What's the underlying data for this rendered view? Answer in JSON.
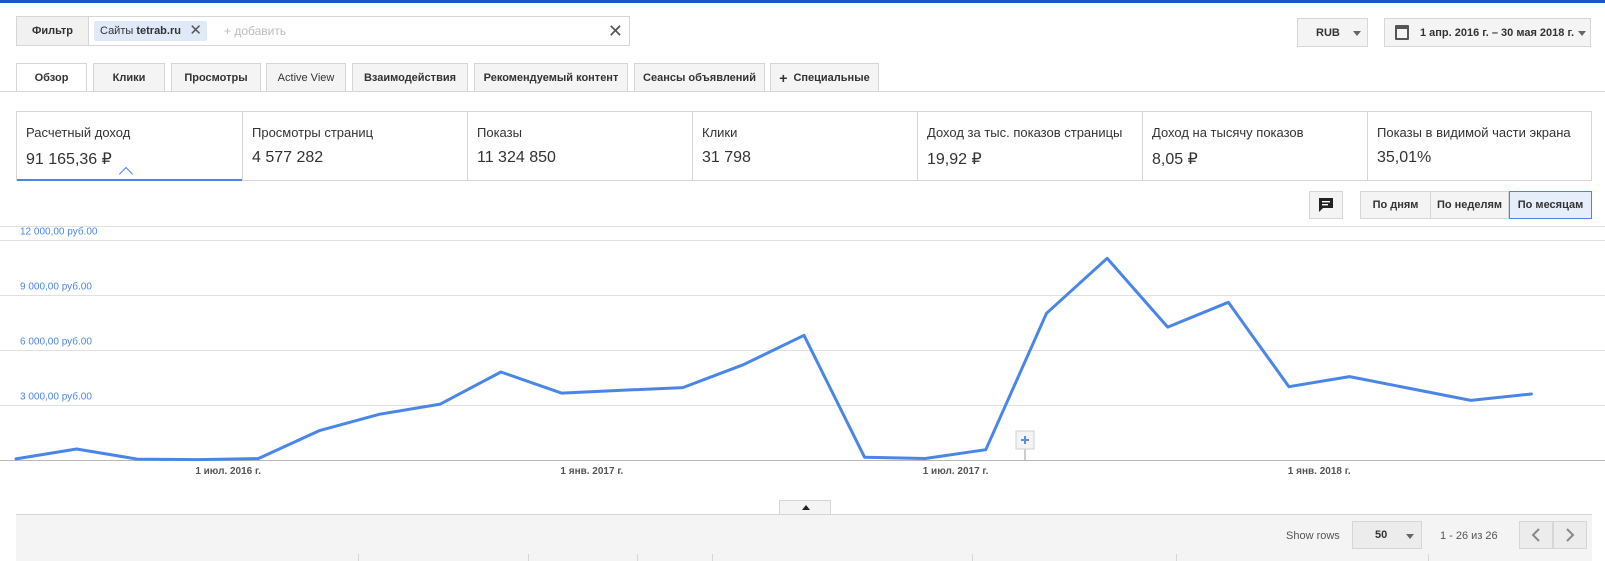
{
  "filter": {
    "button_label": "Фильтр",
    "chip_prefix": "Сайты ",
    "chip_value": "tetrab.ru",
    "add_placeholder": "+ добавить"
  },
  "currency": {
    "value": "RUB"
  },
  "date_range": {
    "label": "1 апр. 2016 г. – 30 мая 2018 г."
  },
  "tabs": [
    {
      "label": "Обзор",
      "active": true
    },
    {
      "label": "Клики"
    },
    {
      "label": "Просмотры"
    },
    {
      "label": "Active View"
    },
    {
      "label": "Взаимодействия"
    },
    {
      "label": "Рекомендуемый контент"
    },
    {
      "label": "Сеансы объявлений"
    },
    {
      "label": "Специальные",
      "icon": "plus-icon"
    }
  ],
  "scorecards": [
    {
      "label": "Расчетный доход",
      "value": "91 165,36 ₽"
    },
    {
      "label": "Просмотры страниц",
      "value": "4 577 282"
    },
    {
      "label": "Показы",
      "value": "11 324 850"
    },
    {
      "label": "Клики",
      "value": "31 798"
    },
    {
      "label": "Доход за тыс. показов страницы",
      "value": "19,92 ₽"
    },
    {
      "label": "Доход на тысячу показов",
      "value": "8,05 ₽"
    },
    {
      "label": "Показы в видимой части экрана",
      "value": "35,01%"
    }
  ],
  "granularity": {
    "days": "По дням",
    "weeks": "По неделям",
    "months": "По месяцам",
    "selected": "months"
  },
  "chart_data": {
    "type": "line",
    "ylim": [
      0,
      12000
    ],
    "y_ticks": [
      12000,
      9000,
      6000,
      3000
    ],
    "y_tick_labels": [
      "12 000,00 руб.00",
      "9 000,00 руб.00",
      "6 000,00 руб.00",
      "3 000,00 руб.00"
    ],
    "x_tick_labels": [
      "1 июл. 2016 г.",
      "1 янв. 2017 г.",
      "1 июл. 2017 г.",
      "1 янв. 2018 г."
    ],
    "x_tick_months": [
      3,
      9,
      15,
      21
    ],
    "month_span": [
      -0.5,
      25.5
    ],
    "series": [
      {
        "color": "#4a86e8",
        "months": [
          -0.5,
          0.5,
          1.5,
          2.5,
          3.5,
          4.5,
          5.5,
          6.5,
          7.5,
          8.5,
          9.5,
          10.5,
          11.5,
          12.5,
          13.5,
          14.5,
          15.5,
          16.5,
          17.5,
          18.5,
          19.5,
          20.5,
          21.5,
          22.5,
          23.5,
          24.5
        ],
        "values": [
          60,
          600,
          50,
          20,
          80,
          1600,
          2500,
          3050,
          4800,
          3650,
          3800,
          3950,
          5200,
          6800,
          150,
          80,
          560,
          8000,
          11000,
          7250,
          8600,
          4000,
          4550,
          3900,
          3250,
          3600
        ]
      }
    ],
    "grid": true,
    "legend": "none",
    "annotation_icon": "plus-icon"
  },
  "table_footer": {
    "show_rows_label": "Show rows",
    "rows_value": "50",
    "range_text": "1 - 26 из 26"
  },
  "icons": {
    "comment": "comment-icon",
    "calendar": "calendar-icon",
    "collapse": "collapse-up-icon",
    "prev": "chevron-left-icon",
    "next": "chevron-right-icon"
  }
}
